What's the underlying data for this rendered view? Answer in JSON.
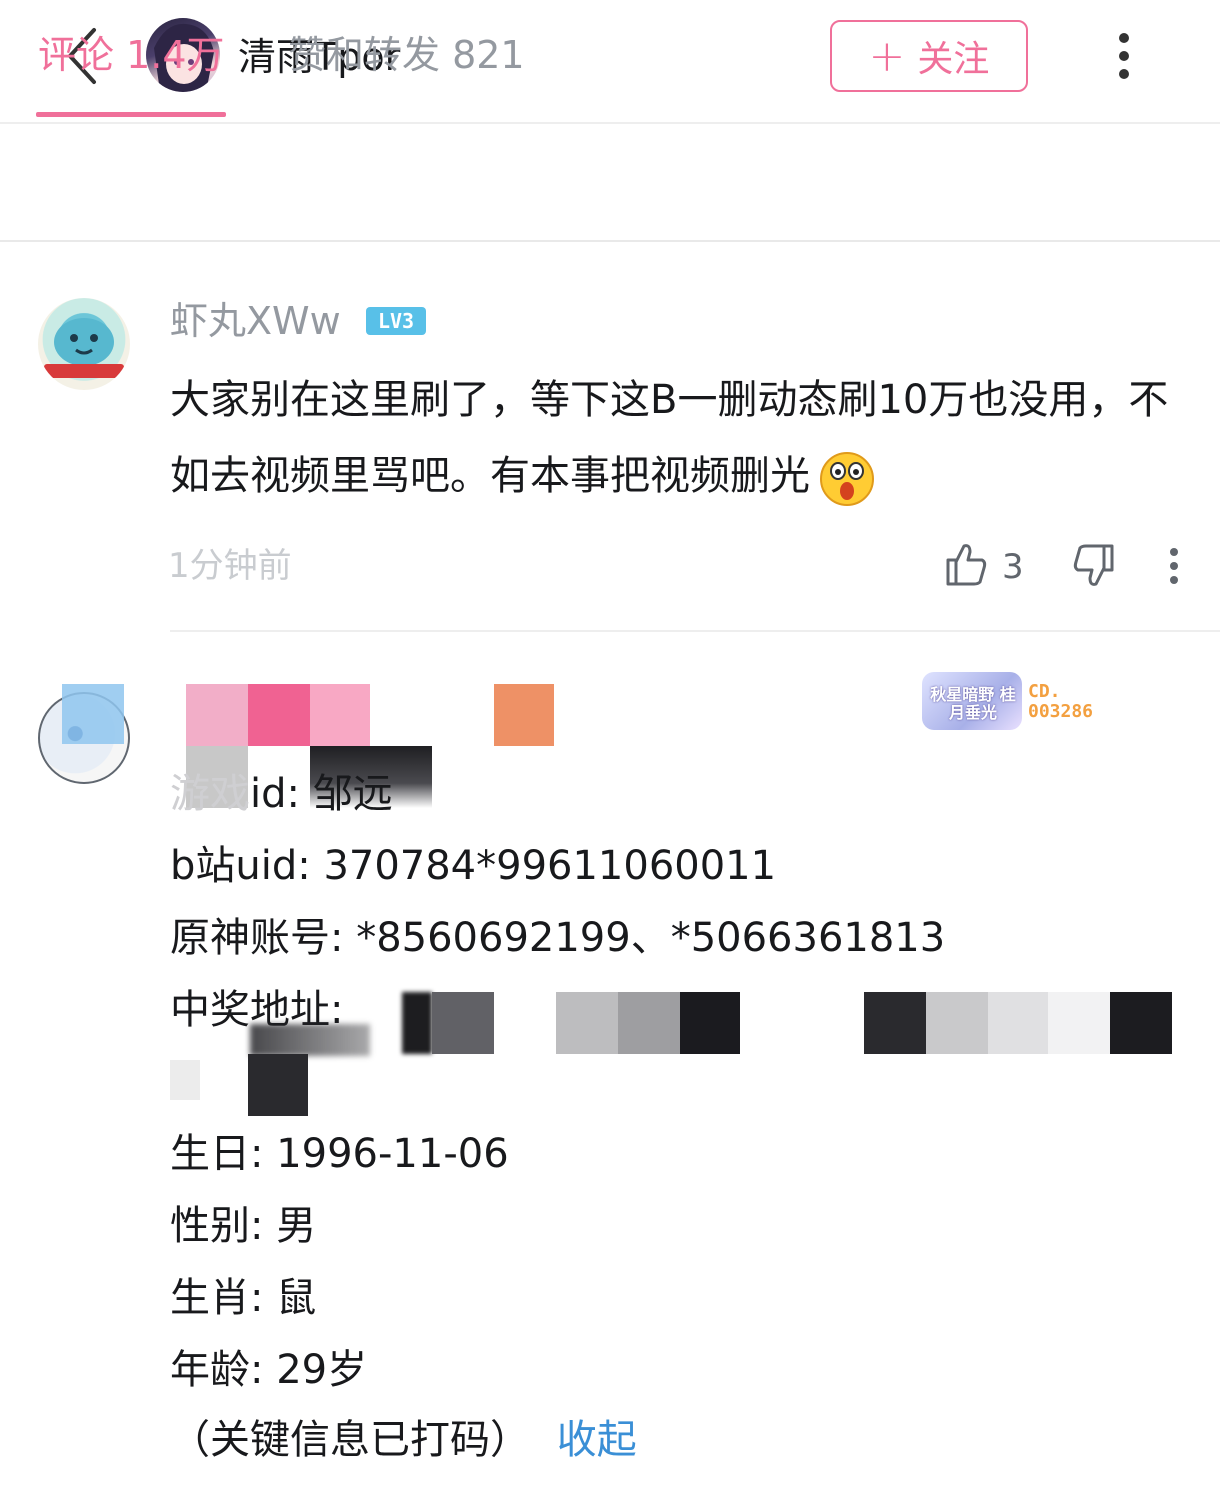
{
  "header": {
    "author_name": "清雨Tpor",
    "follow_label": "关注",
    "icons": [
      "back-icon",
      "plus-icon",
      "more-vertical-icon"
    ]
  },
  "tabs": [
    {
      "label": "评论 1.4万",
      "active": true
    },
    {
      "label": "赞和转发 821",
      "active": false
    }
  ],
  "comments": [
    {
      "username": "虾丸XWw",
      "level": "LV3",
      "text": "大家别在这里刷了，等下这B一删动态刷10万也没用，不如去视频里骂吧。有本事把视频删光",
      "time": "1分钟前",
      "likes": "3"
    },
    {
      "fan_badge_text": "秋星暗野 桂月垂光",
      "fan_number": "CD.\n003286",
      "lines": [
        {
          "label": "",
          "value": "id: 邹远"
        },
        {
          "label": "b站uid: ",
          "value": "370784*99611060011"
        },
        {
          "label": "原神账号: ",
          "value": "*8560692199、*5066361813"
        },
        {
          "label": "中奖地址: ",
          "value": ""
        },
        {
          "label": "生日: ",
          "value": "1996-11-06"
        },
        {
          "label": "性别: ",
          "value": "男"
        },
        {
          "label": "生肖: ",
          "value": "鼠"
        },
        {
          "label": "年龄: ",
          "value": "29岁"
        }
      ],
      "note": "（关键信息已打码）",
      "collapse_label": "收起"
    }
  ],
  "colors": {
    "accent_pink": "#f0709a",
    "link_blue": "#3a8fd6",
    "muted_gray": "#9499a0"
  }
}
